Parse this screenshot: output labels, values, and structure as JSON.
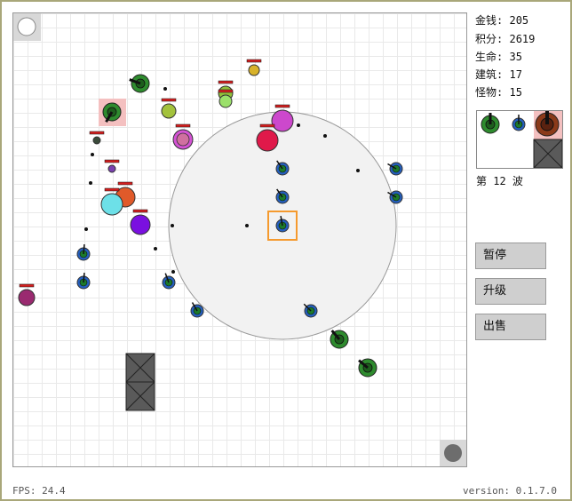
{
  "stats": {
    "money_label": "金钱:",
    "money": "205",
    "score_label": "积分:",
    "score": "2619",
    "life_label": "生命:",
    "life": "35",
    "buildings_label": "建筑:",
    "buildings": "17",
    "monsters_label": "怪物:",
    "monsters": "15"
  },
  "wave": "第 12 波",
  "buttons": {
    "pause": "暂停",
    "upgrade": "升级",
    "sell": "出售"
  },
  "fps": "FPS: 24.4",
  "version": "version: 0.1.7.0",
  "colors": {
    "range": "#f2f2f2",
    "selection": "#f59a2e",
    "cannon": "#2e8b2e",
    "laser": "#2560c0",
    "heavy": "#8b3a1a",
    "hp_bar": "#d62020"
  },
  "icons": {
    "entrance": "white-circle-icon",
    "exit": "gray-circle-icon",
    "wall": "crossed-box-icon",
    "tower_cannon": "green-cannon-tower-icon",
    "tower_laser": "blue-laser-tower-icon",
    "tower_heavy": "brown-heavy-tower-icon"
  }
}
